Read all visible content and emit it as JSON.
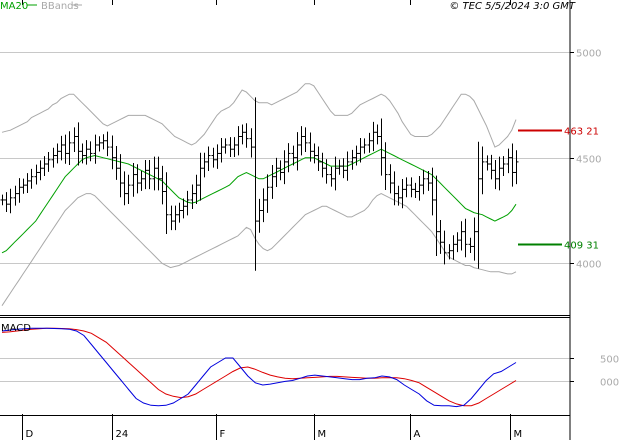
{
  "header": {
    "legend": [
      {
        "label": "MA20",
        "color": "#00a000"
      },
      {
        "label": "BBands",
        "color": "#a9a9a9"
      }
    ],
    "copyright": "© TEC 5/5/2024 3:0 GMT"
  },
  "chart_data": [
    {
      "type": "candlestick",
      "panel": "price",
      "y_ticks": [
        "5000",
        "4500",
        "4000"
      ],
      "ylim": [
        3770,
        5170
      ],
      "grid": true,
      "x_ticks": [
        "D",
        "24",
        "F",
        "M",
        "A",
        "M"
      ],
      "series_colors": {
        "ma20": "#00a000",
        "bbands": "#a9a9a9",
        "price": "#000000"
      },
      "annotations": [
        {
          "label": "463 21",
          "value": 4632.1,
          "color": "#cc0000"
        },
        {
          "label": "409 31",
          "value": 4093.1,
          "color": "#008000"
        }
      ],
      "close": [
        4300,
        4280,
        4310,
        4330,
        4360,
        4370,
        4390,
        4410,
        4430,
        4450,
        4470,
        4490,
        4510,
        4530,
        4560,
        4520,
        4570,
        4600,
        4530,
        4510,
        4540,
        4520,
        4560,
        4570,
        4580,
        4550,
        4500,
        4450,
        4380,
        4330,
        4370,
        4420,
        4380,
        4400,
        4440,
        4400,
        4450,
        4400,
        4340,
        4230,
        4200,
        4230,
        4250,
        4270,
        4300,
        4330,
        4370,
        4450,
        4480,
        4510,
        4490,
        4520,
        4550,
        4560,
        4540,
        4560,
        4600,
        4620,
        4590,
        4550,
        4200,
        4250,
        4300,
        4360,
        4410,
        4450,
        4430,
        4480,
        4520,
        4500,
        4560,
        4600,
        4570,
        4530,
        4510,
        4480,
        4450,
        4420,
        4400,
        4450,
        4460,
        4440,
        4480,
        4500,
        4520,
        4550,
        4560,
        4580,
        4620,
        4600,
        4500,
        4420,
        4380,
        4330,
        4310,
        4350,
        4370,
        4350,
        4340,
        4370,
        4400,
        4380,
        4300,
        4150,
        4100,
        4050,
        4060,
        4090,
        4110,
        4150,
        4090,
        4080,
        4150,
        4400,
        4480,
        4470,
        4440,
        4400,
        4450,
        4470,
        4500,
        4430,
        4480
      ],
      "ma20": [
        4050,
        4060,
        4080,
        4100,
        4120,
        4140,
        4160,
        4180,
        4200,
        4230,
        4260,
        4290,
        4320,
        4350,
        4380,
        4410,
        4430,
        4450,
        4470,
        4490,
        4500,
        4505,
        4510,
        4505,
        4500,
        4495,
        4490,
        4485,
        4480,
        4475,
        4470,
        4460,
        4450,
        4440,
        4430,
        4420,
        4410,
        4400,
        4390,
        4370,
        4350,
        4330,
        4310,
        4300,
        4290,
        4285,
        4290,
        4300,
        4310,
        4320,
        4330,
        4340,
        4350,
        4360,
        4370,
        4390,
        4410,
        4420,
        4430,
        4420,
        4410,
        4400,
        4400,
        4410,
        4420,
        4430,
        4440,
        4450,
        4460,
        4470,
        4480,
        4490,
        4500,
        4500,
        4500,
        4490,
        4480,
        4470,
        4460,
        4460,
        4460,
        4460,
        4460,
        4470,
        4480,
        4490,
        4500,
        4510,
        4520,
        4530,
        4540,
        4530,
        4520,
        4510,
        4500,
        4490,
        4480,
        4470,
        4460,
        4450,
        4440,
        4430,
        4420,
        4400,
        4380,
        4360,
        4340,
        4320,
        4300,
        4280,
        4260,
        4250,
        4240,
        4235,
        4230,
        4220,
        4210,
        4200,
        4210,
        4220,
        4230,
        4250,
        4280
      ],
      "bb_upper": [
        4620,
        4625,
        4630,
        4640,
        4650,
        4660,
        4670,
        4690,
        4700,
        4710,
        4720,
        4730,
        4750,
        4760,
        4780,
        4790,
        4800,
        4800,
        4780,
        4760,
        4740,
        4720,
        4700,
        4680,
        4660,
        4650,
        4660,
        4670,
        4680,
        4690,
        4700,
        4700,
        4700,
        4700,
        4700,
        4690,
        4680,
        4670,
        4660,
        4640,
        4620,
        4600,
        4590,
        4580,
        4570,
        4560,
        4570,
        4590,
        4610,
        4640,
        4670,
        4700,
        4720,
        4730,
        4740,
        4760,
        4790,
        4820,
        4810,
        4790,
        4770,
        4760,
        4760,
        4760,
        4750,
        4760,
        4770,
        4780,
        4790,
        4800,
        4810,
        4830,
        4850,
        4850,
        4840,
        4810,
        4780,
        4750,
        4720,
        4700,
        4700,
        4700,
        4700,
        4710,
        4730,
        4750,
        4760,
        4770,
        4780,
        4790,
        4800,
        4790,
        4770,
        4740,
        4710,
        4670,
        4640,
        4610,
        4600,
        4600,
        4600,
        4600,
        4610,
        4630,
        4650,
        4680,
        4710,
        4740,
        4770,
        4800,
        4800,
        4790,
        4770,
        4730,
        4690,
        4650,
        4600,
        4550,
        4560,
        4580,
        4600,
        4630,
        4680
      ],
      "bb_lower": [
        3800,
        3830,
        3860,
        3890,
        3920,
        3950,
        3980,
        4010,
        4040,
        4070,
        4100,
        4130,
        4160,
        4190,
        4220,
        4250,
        4270,
        4290,
        4310,
        4320,
        4330,
        4330,
        4320,
        4300,
        4280,
        4260,
        4240,
        4220,
        4200,
        4180,
        4160,
        4140,
        4120,
        4100,
        4080,
        4060,
        4040,
        4020,
        4000,
        3990,
        3980,
        3985,
        3990,
        4000,
        4010,
        4020,
        4030,
        4040,
        4050,
        4060,
        4070,
        4080,
        4090,
        4100,
        4110,
        4120,
        4130,
        4150,
        4170,
        4160,
        4120,
        4090,
        4070,
        4060,
        4070,
        4090,
        4110,
        4130,
        4150,
        4170,
        4190,
        4210,
        4230,
        4240,
        4250,
        4260,
        4270,
        4270,
        4260,
        4250,
        4240,
        4230,
        4220,
        4220,
        4230,
        4240,
        4250,
        4270,
        4300,
        4320,
        4330,
        4320,
        4310,
        4300,
        4290,
        4280,
        4270,
        4250,
        4230,
        4210,
        4190,
        4170,
        4150,
        4120,
        4090,
        4060,
        4030,
        4020,
        4010,
        4000,
        3990,
        3990,
        3980,
        3975,
        3970,
        3965,
        3960,
        3960,
        3960,
        3955,
        3950,
        3950,
        3960
      ]
    },
    {
      "type": "line",
      "panel": "indicator",
      "title": "MACD",
      "y_ticks": [
        "500",
        "000"
      ],
      "ylim": [
        -700,
        1300
      ],
      "grid": true,
      "series_colors": {
        "macd": "#0000dd",
        "signal": "#dd0000"
      },
      "macd": [
        1100,
        1120,
        1140,
        1150,
        1160,
        1160,
        1160,
        1155,
        1150,
        1140,
        1100,
        1000,
        800,
        600,
        400,
        200,
        0,
        -200,
        -400,
        -500,
        -550,
        -560,
        -550,
        -500,
        -400,
        -300,
        -100,
        100,
        300,
        400,
        500,
        500,
        300,
        100,
        -50,
        -100,
        -80,
        -50,
        -20,
        0,
        50,
        100,
        120,
        100,
        80,
        60,
        40,
        20,
        20,
        50,
        60,
        100,
        80,
        20,
        -100,
        -200,
        -300,
        -450,
        -550,
        -560,
        -560,
        -580,
        -550,
        -400,
        -200,
        0,
        150,
        200,
        300,
        400
      ],
      "signal": [
        1070,
        1080,
        1100,
        1120,
        1140,
        1150,
        1160,
        1160,
        1155,
        1150,
        1130,
        1100,
        1050,
        950,
        850,
        700,
        550,
        400,
        250,
        100,
        -50,
        -200,
        -300,
        -350,
        -380,
        -360,
        -300,
        -200,
        -100,
        0,
        100,
        200,
        280,
        300,
        250,
        180,
        120,
        80,
        50,
        40,
        50,
        60,
        70,
        80,
        90,
        90,
        80,
        70,
        60,
        50,
        50,
        60,
        65,
        60,
        40,
        0,
        -50,
        -150,
        -250,
        -350,
        -450,
        -520,
        -560,
        -560,
        -500,
        -400,
        -300,
        -200,
        -100,
        0
      ]
    }
  ]
}
